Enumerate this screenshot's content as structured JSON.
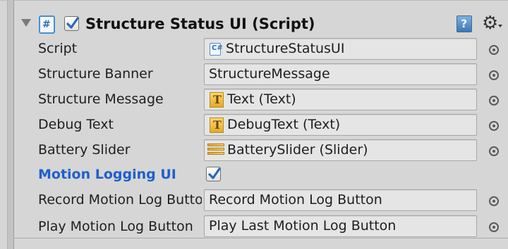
{
  "component": {
    "title": "Structure Status UI (Script)",
    "enabled": true,
    "expanded": true,
    "icons": {
      "foldout": "triangle-down-icon",
      "script": "csharp-script-icon",
      "help": "help-book-icon",
      "settings": "gear-icon"
    }
  },
  "rows": [
    {
      "label": "Script",
      "value": "StructureStatusUI",
      "icon": "csharp-script-icon",
      "icon_glyph": "C#"
    },
    {
      "label": "Structure Banner",
      "value": "StructureMessage"
    },
    {
      "label": "Structure Message",
      "value": "Text (Text)",
      "icon": "text-component-icon",
      "icon_glyph": "T"
    },
    {
      "label": "Debug Text",
      "value": "DebugText (Text)",
      "icon": "text-component-icon",
      "icon_glyph": "T"
    },
    {
      "label": "Battery Slider",
      "value": "BatterySlider (Slider)",
      "icon": "slider-component-icon"
    },
    {
      "label": "Motion Logging UI",
      "checked": true,
      "highlight_color": "#1f5fcc"
    },
    {
      "label": "Record Motion Log Button",
      "value": "Record Motion Log Button"
    },
    {
      "label": "Play Motion Log Button",
      "value": "Play Last Motion Log Button"
    }
  ],
  "picker_icon": "object-picker-icon"
}
